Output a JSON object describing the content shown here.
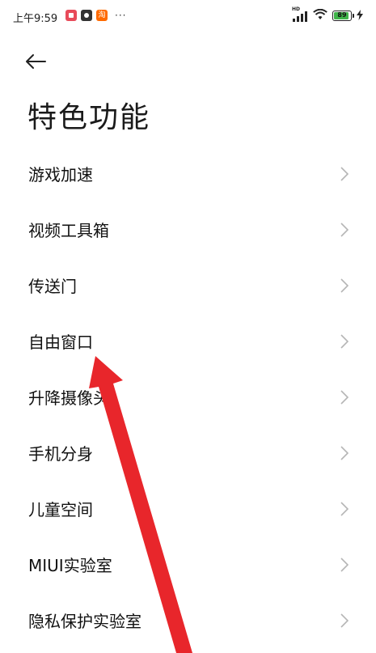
{
  "status_bar": {
    "time": "上午9:59",
    "more": "···",
    "network_tag": "HD",
    "battery_level": "89",
    "battery_fraction": 0.89,
    "colors": {
      "battery_fill": "#3fb44a"
    },
    "notification_icons": [
      {
        "icon": "app-notification-icon-1",
        "glyph": "",
        "color": "#e84b5a"
      },
      {
        "icon": "app-notification-icon-2",
        "glyph": "",
        "color": "#333333"
      },
      {
        "icon": "taobao-icon",
        "glyph": "淘",
        "color": "#ff6a00"
      }
    ]
  },
  "header": {
    "back_icon": "arrow-left-icon",
    "title": "特色功能"
  },
  "menu": {
    "items": [
      {
        "label": "游戏加速",
        "icon": "chevron-right-icon"
      },
      {
        "label": "视频工具箱",
        "icon": "chevron-right-icon"
      },
      {
        "label": "传送门",
        "icon": "chevron-right-icon"
      },
      {
        "label": "自由窗口",
        "icon": "chevron-right-icon"
      },
      {
        "label": "升降摄像头",
        "icon": "chevron-right-icon"
      },
      {
        "label": "手机分身",
        "icon": "chevron-right-icon"
      },
      {
        "label": "儿童空间",
        "icon": "chevron-right-icon"
      },
      {
        "label": "MIUI实验室",
        "icon": "chevron-right-icon"
      },
      {
        "label": "隐私保护实验室",
        "icon": "chevron-right-icon"
      }
    ]
  },
  "annotation": {
    "icon": "red-pointer-arrow-icon",
    "color": "#e8262b"
  }
}
